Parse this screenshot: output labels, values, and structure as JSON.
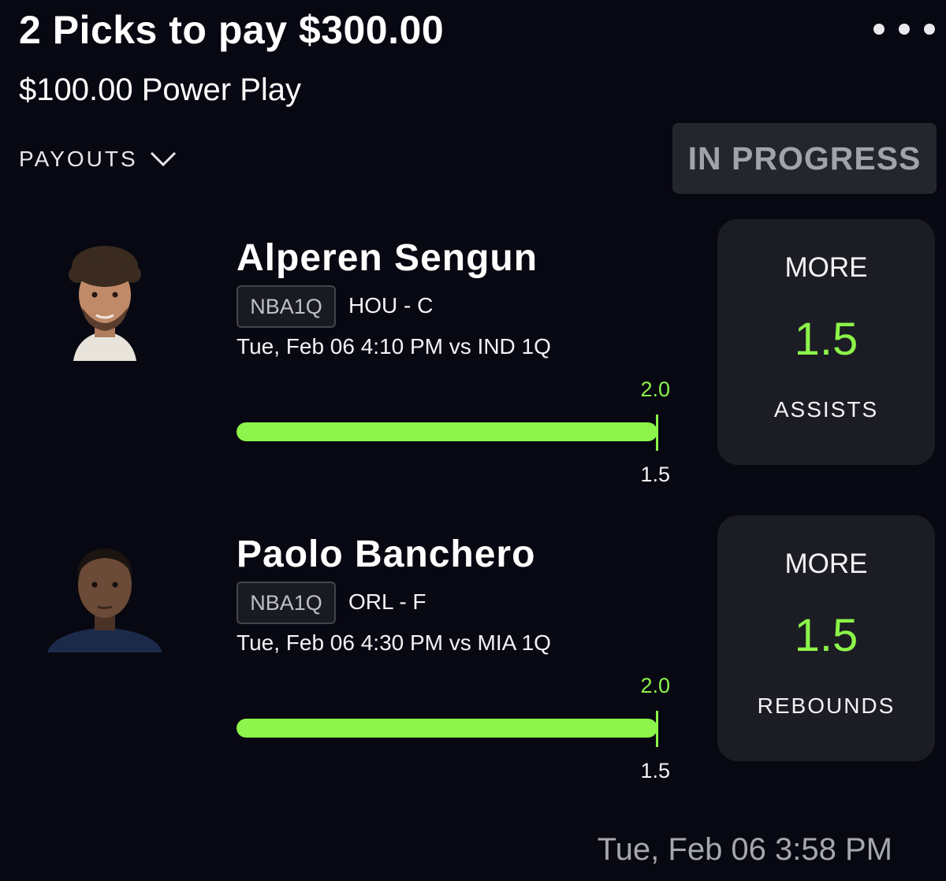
{
  "header": {
    "title": "2 Picks to pay $300.00",
    "subtitle": "$100.00 Power Play",
    "payouts_label": "PAYOUTS",
    "status": "IN PROGRESS"
  },
  "picks": [
    {
      "player": "Alperen Sengun",
      "league": "NBA1Q",
      "team_position": "HOU - C",
      "game_time": "Tue, Feb 06 4:10 PM  vs IND 1Q",
      "current_value": "2.0",
      "line_value": "1.5",
      "progress_percent": 100,
      "direction": "MORE",
      "line": "1.5",
      "stat": "ASSISTS"
    },
    {
      "player": "Paolo Banchero",
      "league": "NBA1Q",
      "team_position": "ORL - F",
      "game_time": "Tue, Feb 06 4:30 PM  vs MIA 1Q",
      "current_value": "2.0",
      "line_value": "1.5",
      "progress_percent": 100,
      "direction": "MORE",
      "line": "1.5",
      "stat": "REBOUNDS"
    }
  ],
  "footer": {
    "timestamp": "Tue, Feb 06 3:58 PM"
  },
  "colors": {
    "background": "#080812",
    "accent_green": "#8cf44a",
    "card": "#1c1d24",
    "badge": "#24262e"
  }
}
